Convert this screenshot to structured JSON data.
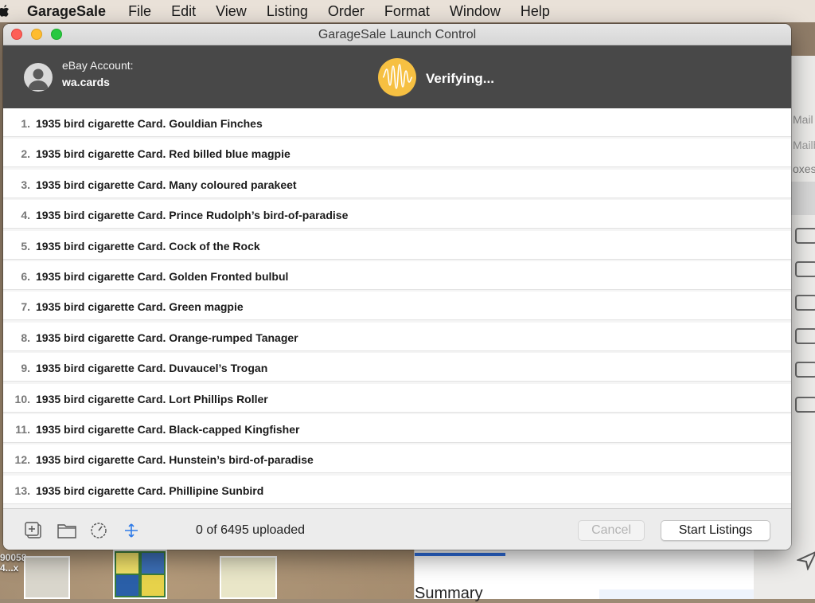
{
  "menubar": {
    "app": "GarageSale",
    "menus": [
      "File",
      "Edit",
      "View",
      "Listing",
      "Order",
      "Format",
      "Window",
      "Help"
    ]
  },
  "window": {
    "title": "GarageSale Launch Control"
  },
  "header": {
    "account_label": "eBay Account:",
    "account_name": "wa.cards",
    "status": "Verifying...",
    "accent": "#f6c042"
  },
  "listings": [
    {
      "num": "1.",
      "title": "1935 bird cigarette Card. Gouldian Finches"
    },
    {
      "num": "2.",
      "title": "1935 bird cigarette Card. Red billed blue magpie"
    },
    {
      "num": "3.",
      "title": "1935 bird cigarette Card. Many coloured parakeet"
    },
    {
      "num": "4.",
      "title": "1935 bird cigarette Card. Prince Rudolph’s bird-of-paradise"
    },
    {
      "num": "5.",
      "title": "1935 bird cigarette Card. Cock of the Rock"
    },
    {
      "num": "6.",
      "title": "1935 bird cigarette Card. Golden Fronted bulbul"
    },
    {
      "num": "7.",
      "title": "1935 bird cigarette Card. Green magpie"
    },
    {
      "num": "8.",
      "title": "1935 bird cigarette Card. Orange-rumped Tanager"
    },
    {
      "num": "9.",
      "title": "1935 bird cigarette Card. Duvaucel’s Trogan"
    },
    {
      "num": "10.",
      "title": "1935 bird cigarette Card. Lort Phillips Roller"
    },
    {
      "num": "11.",
      "title": "1935 bird cigarette Card. Black-capped Kingfisher"
    },
    {
      "num": "12.",
      "title": "1935 bird cigarette Card. Hunstein’s bird-of-paradise"
    },
    {
      "num": "13.",
      "title": "1935 bird cigarette Card. Phillipine Sunbird"
    }
  ],
  "footer": {
    "upload_status": "0 of 6495 uploaded",
    "cancel_label": "Cancel",
    "start_label": "Start Listings",
    "icons": [
      "add-listing-icon",
      "folder-icon",
      "speed-gauge-icon",
      "network-icon"
    ]
  },
  "background": {
    "desktop_label": "90058\n4...x",
    "mail_fragments": [
      "Mail",
      "Mailb",
      "oxes"
    ],
    "doc_heading": "Summary"
  }
}
